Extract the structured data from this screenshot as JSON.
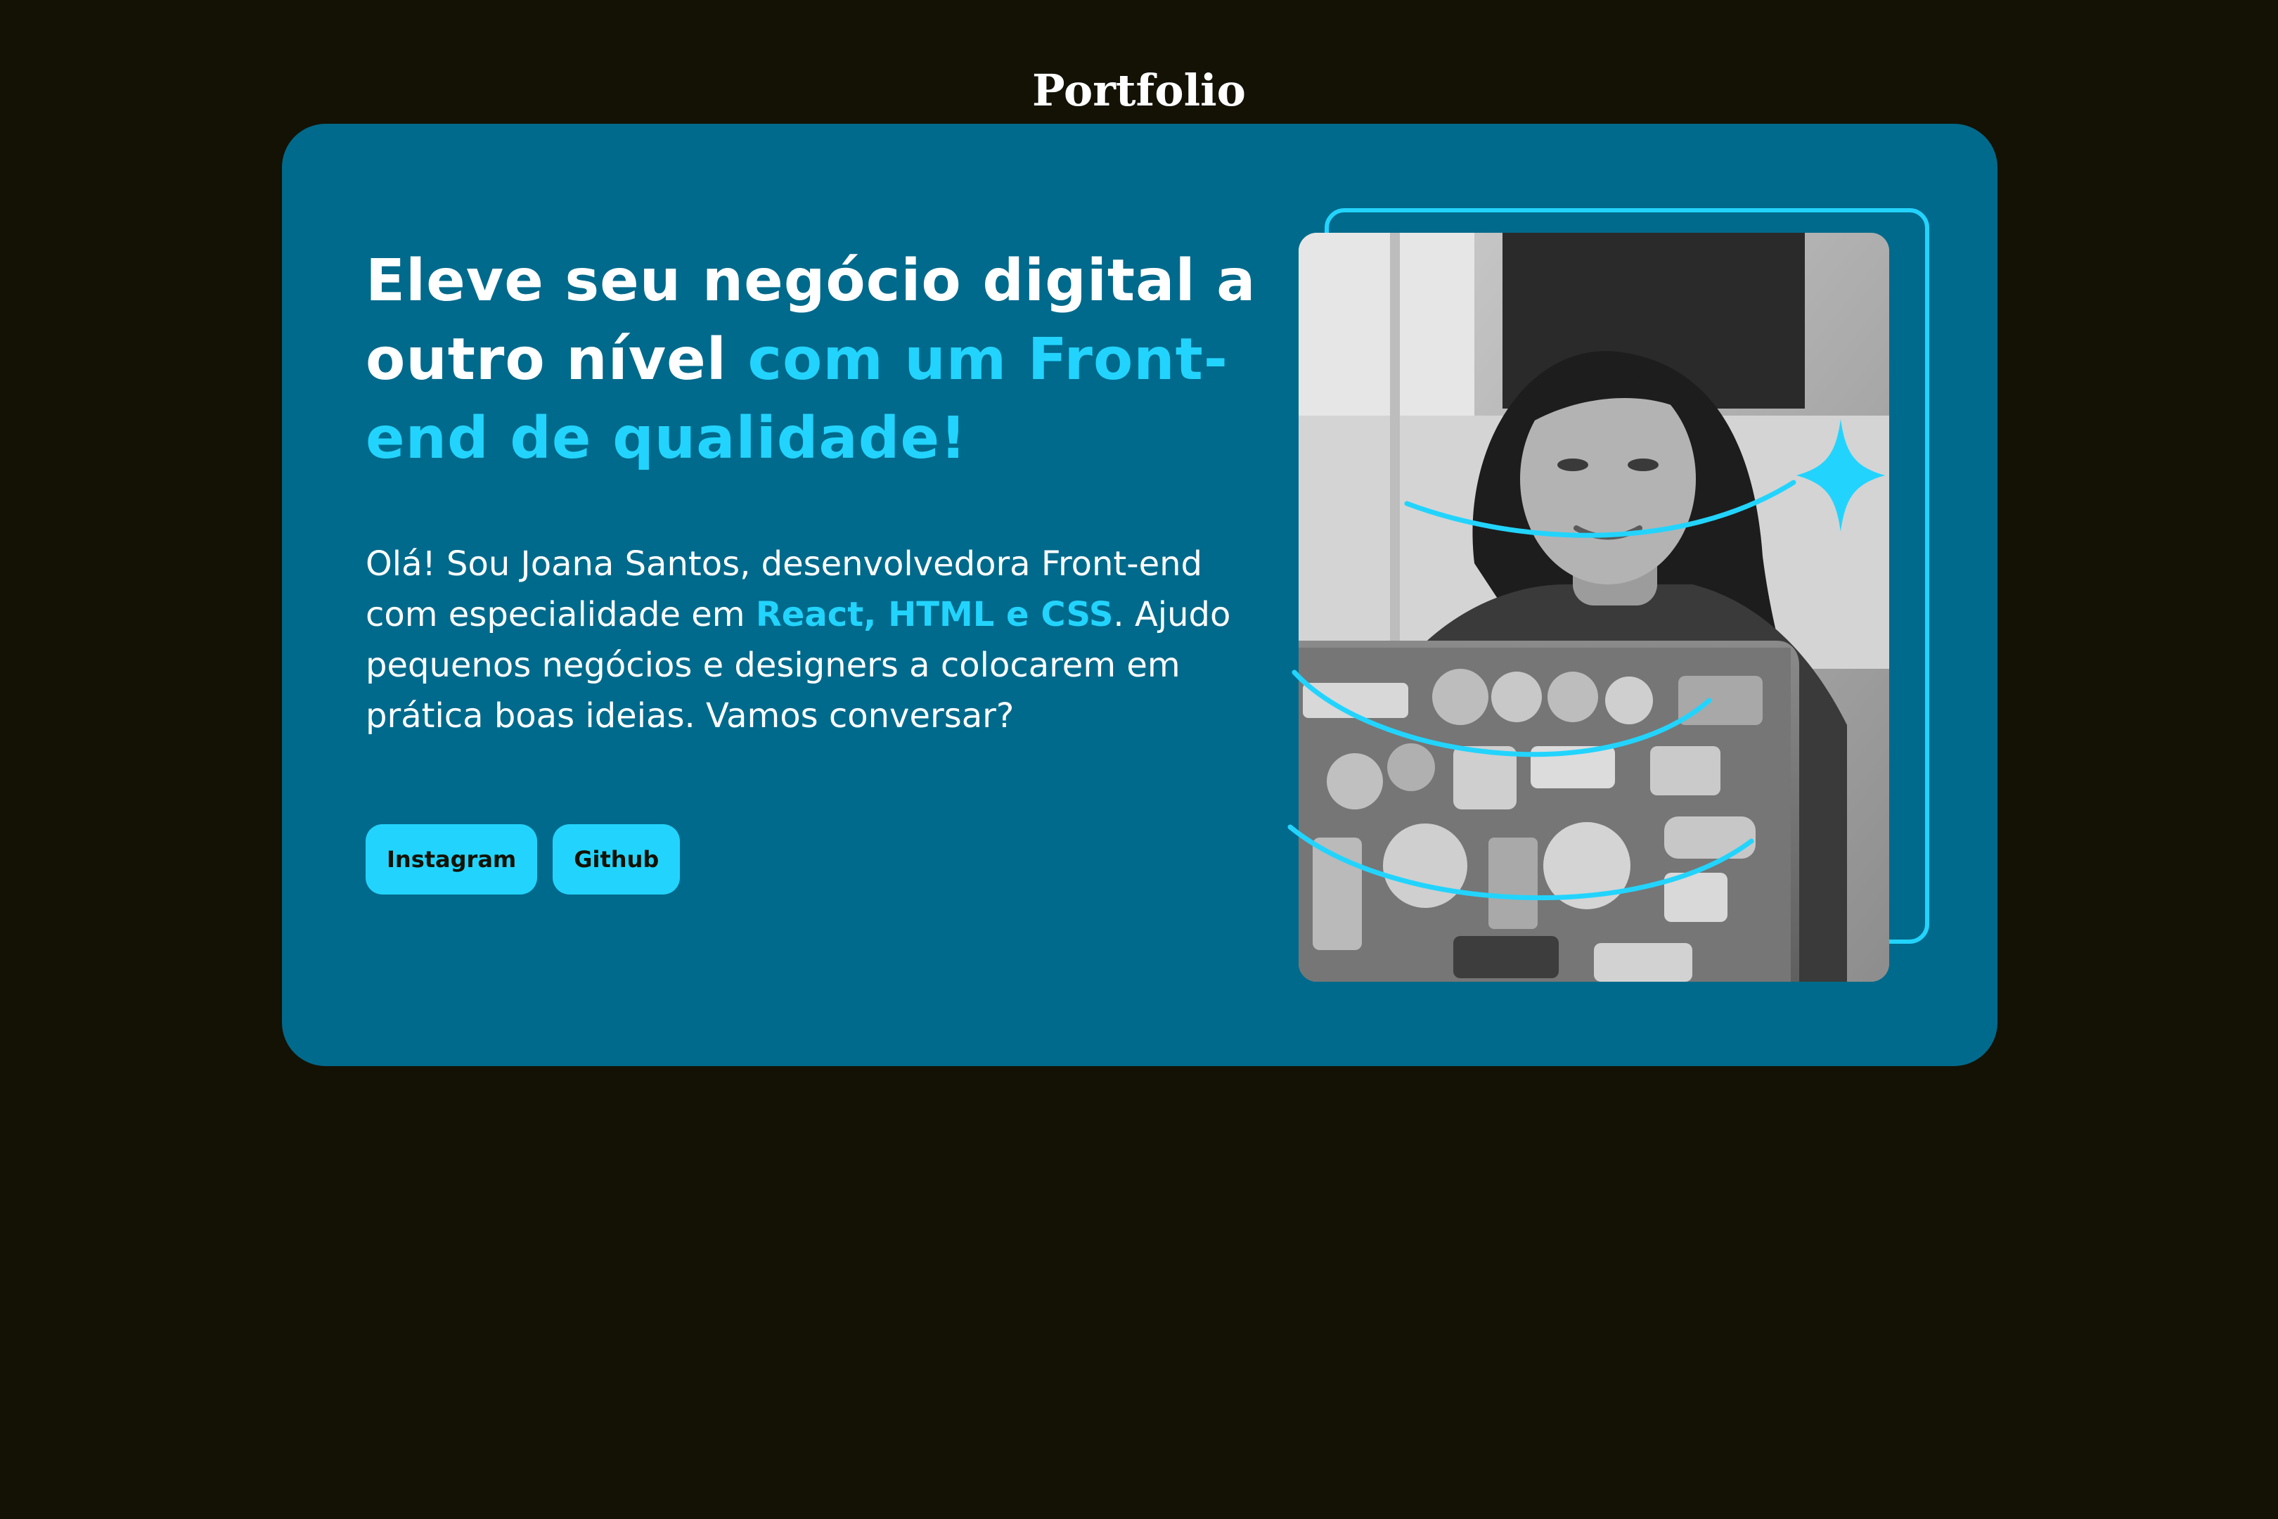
{
  "page": {
    "title": "Portfolio"
  },
  "hero": {
    "headline_white": "Eleve seu negócio digital a outro nível",
    "headline_accent": "com um Front-end de qualidade!",
    "intro_before": "Olá! Sou Joana Santos, desenvolvedora Front-end com especialidade em",
    "intro_highlight": "React, HTML e CSS",
    "intro_after": ". Ajudo pequenos negócios e designers a colocarem em prática boas ideias. Vamos conversar?",
    "photo_alt": "Joana Santos sorrindo em frente a um notebook com adesivos"
  },
  "buttons": {
    "instagram_label": "Instagram",
    "github_label": "Github"
  },
  "colors": {
    "page_background": "#141204",
    "card_background": "#006a8c",
    "accent": "#22d4fd",
    "text": "#ffffff"
  }
}
